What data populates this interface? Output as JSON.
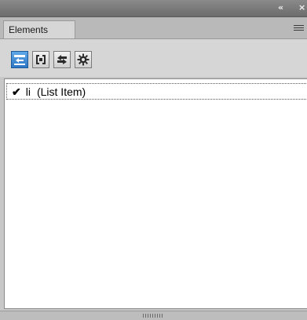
{
  "titlebar": {
    "collapse_glyph": "«",
    "close_glyph": "×"
  },
  "tabs": [
    {
      "label": "Elements",
      "active": true
    }
  ],
  "toolbar": {
    "buttons": [
      {
        "icon": "select-parent-icon",
        "active": true
      },
      {
        "icon": "select-element-icon",
        "active": false
      },
      {
        "icon": "swap-icon",
        "active": false
      },
      {
        "icon": "gear-icon",
        "active": false
      }
    ]
  },
  "list": {
    "items": [
      {
        "checked": true,
        "check": "✔",
        "tag": "li",
        "label": "(List Item)"
      }
    ]
  },
  "colors": {
    "accent": "#2d76c4",
    "panel_bg": "#ffffff",
    "chrome_bg": "#d6d6d6"
  }
}
